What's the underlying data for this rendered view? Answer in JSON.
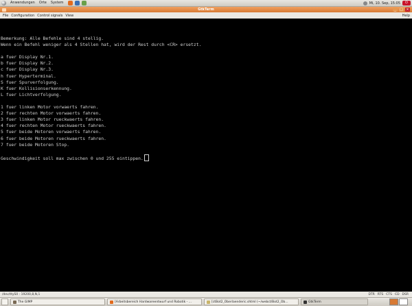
{
  "top_panel": {
    "menus": [
      "Anwendungen",
      "Orte",
      "System"
    ],
    "launcher_icons": [
      "firefox-icon",
      "help-icon",
      "mail-icon"
    ],
    "clock": "Mi, 10. Sep, 15:05",
    "colors": {
      "power": "#c8132a"
    }
  },
  "window": {
    "title": "GtkTerm",
    "buttons": [
      "minimize",
      "maximize",
      "close"
    ],
    "accent": "#d77a34"
  },
  "menubar": {
    "items": [
      "File",
      "Configuration",
      "Control signals",
      "View"
    ],
    "help": "Help"
  },
  "terminal": {
    "text": "Bemerkung: Alle Befehle sind 4 stellig.\nWenn ein Befehl weniger als 4 Stellen hat, wird der Rest durch <CR> ersetzt.\n\na fuer Display Nr.1.\nb fuer Display Nr.2.\nc fuer Display Nr.3.\nh fuer Hyperterminal.\nS fuer Spurverfolgung.\nK fuer Kollisionserkennung.\nL fuer Lichtverfolgung.\n\n1 fuer linken Motor vorwaerts fahren.\n2 fuer rechten Motor vorwaerts fahren.\n3 fuer linken Motor rueckwaerts fahren.\n4 fuer rechten Motor rueckwaerts fahren.\n5 fuer beide Motoren vorwaerts fahren.\n6 fuer beide Motoren rueckwaerts fahren.\n7 fuer beide Motoren Stop.\n\nGeschwindigkeit soll max zwischen 0 und 255 eintippen.",
    "fg": "#d2d2d2",
    "bg": "#000000"
  },
  "statusbar": {
    "port": "/dev/ttyS0 : 19200,8,N,1",
    "signals": [
      "DTR",
      "RTS",
      "CTS",
      "CD",
      "DSR"
    ]
  },
  "taskbar": {
    "tasks": [
      {
        "label": "The GIMP",
        "icon": "gimp-icon"
      },
      {
        "label": "[Arbeitsbereich Hardwareentwurf und Robotik - ...",
        "icon": "firefox-icon"
      },
      {
        "label": "[ctBot2_Oberlaenderic.shtml (~/webct/Bot2_Ob...",
        "icon": "editor-icon"
      },
      {
        "label": "GtkTerm",
        "icon": "terminal-icon"
      }
    ],
    "workspace_count": 2,
    "active_workspace": 1
  }
}
